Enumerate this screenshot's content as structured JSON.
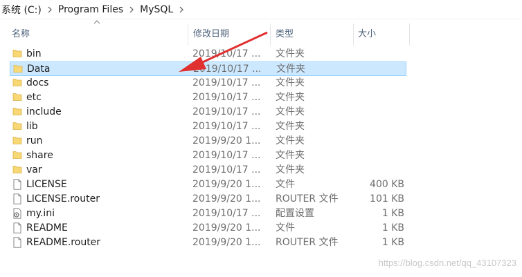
{
  "breadcrumb": [
    "系统 (C:)",
    "Program Files",
    "MySQL"
  ],
  "columns": {
    "name": "名称",
    "date": "修改日期",
    "type": "类型",
    "size": "大小"
  },
  "files": [
    {
      "name": "bin",
      "date": "2019/10/17 ...",
      "type": "文件夹",
      "size": "",
      "icon": "folder-icon"
    },
    {
      "name": "Data",
      "date": "2019/10/17 ...",
      "type": "文件夹",
      "size": "",
      "icon": "folder-icon",
      "selected": true
    },
    {
      "name": "docs",
      "date": "2019/10/17 ...",
      "type": "文件夹",
      "size": "",
      "icon": "folder-icon"
    },
    {
      "name": "etc",
      "date": "2019/10/17 ...",
      "type": "文件夹",
      "size": "",
      "icon": "folder-icon"
    },
    {
      "name": "include",
      "date": "2019/10/17 ...",
      "type": "文件夹",
      "size": "",
      "icon": "folder-icon"
    },
    {
      "name": "lib",
      "date": "2019/10/17 ...",
      "type": "文件夹",
      "size": "",
      "icon": "folder-icon"
    },
    {
      "name": "run",
      "date": "2019/9/20 1...",
      "type": "文件夹",
      "size": "",
      "icon": "folder-icon"
    },
    {
      "name": "share",
      "date": "2019/10/17 ...",
      "type": "文件夹",
      "size": "",
      "icon": "folder-icon"
    },
    {
      "name": "var",
      "date": "2019/10/17 ...",
      "type": "文件夹",
      "size": "",
      "icon": "folder-icon"
    },
    {
      "name": "LICENSE",
      "date": "2019/9/20 1...",
      "type": "文件",
      "size": "400 KB",
      "icon": "file-icon"
    },
    {
      "name": "LICENSE.router",
      "date": "2019/9/20 1...",
      "type": "ROUTER 文件",
      "size": "101 KB",
      "icon": "file-icon"
    },
    {
      "name": "my.ini",
      "date": "2019/10/17 ...",
      "type": "配置设置",
      "size": "1 KB",
      "icon": "config-file-icon"
    },
    {
      "name": "README",
      "date": "2019/9/20 1...",
      "type": "文件",
      "size": "1 KB",
      "icon": "file-icon"
    },
    {
      "name": "README.router",
      "date": "2019/9/20 1...",
      "type": "ROUTER 文件",
      "size": "1 KB",
      "icon": "file-icon"
    }
  ],
  "watermark": "https://blog.csdn.net/qq_43107323",
  "colors": {
    "selection_bg": "#cce8ff",
    "selection_border": "#99d1ff",
    "folder": "#f8d775",
    "arrow": "#e03030"
  }
}
